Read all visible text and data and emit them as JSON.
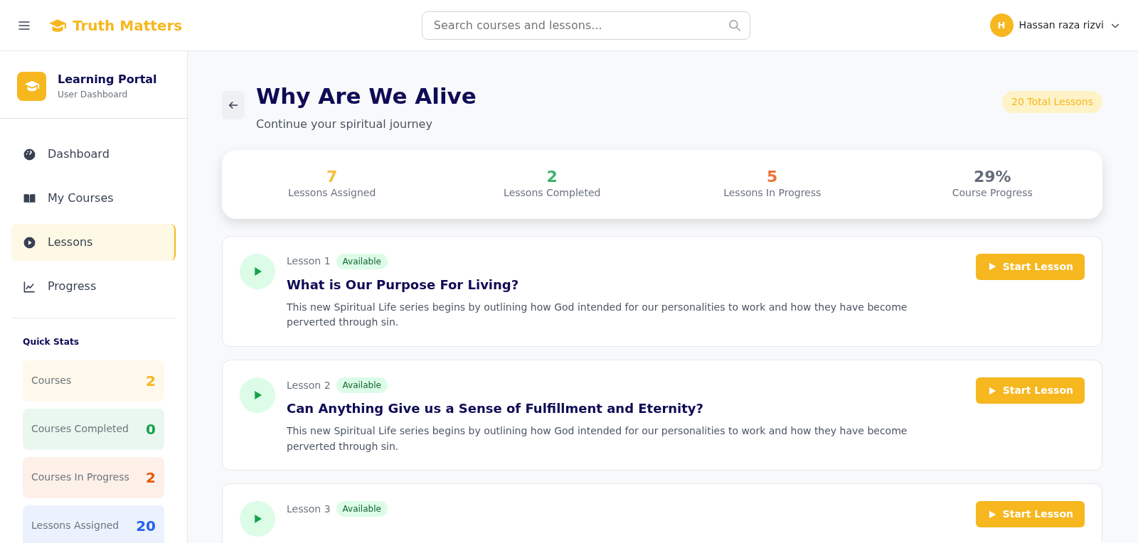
{
  "header": {
    "brand": "Truth Matters",
    "search": {
      "placeholder": "Search courses and lessons..."
    },
    "user": {
      "initial": "H",
      "name": "Hassan raza rizvi"
    }
  },
  "sidebar": {
    "title": "Learning Portal",
    "subtitle": "User Dashboard",
    "items": [
      {
        "label": "Dashboard",
        "selected": false
      },
      {
        "label": "My Courses",
        "selected": false
      },
      {
        "label": "Lessons",
        "selected": true
      },
      {
        "label": "Progress",
        "selected": false
      }
    ],
    "quick_stats_title": "Quick Stats",
    "quick_stats": [
      {
        "label": "Courses",
        "value": "2",
        "color": "#f6b71f"
      },
      {
        "label": "Courses Completed",
        "value": "0",
        "color": "#16a34a"
      },
      {
        "label": "Courses In Progress",
        "value": "2",
        "color": "#ea580c"
      },
      {
        "label": "Lessons Assigned",
        "value": "20",
        "color": "#2563eb"
      }
    ]
  },
  "page": {
    "title": "Why Are We Alive",
    "subtitle": "Continue your spiritual journey",
    "total_badge": "20 Total Lessons"
  },
  "stats": [
    {
      "value": "7",
      "label": "Lessons Assigned",
      "color": "#f5be3b"
    },
    {
      "value": "2",
      "label": "Lessons Completed",
      "color": "#3cb46a"
    },
    {
      "value": "5",
      "label": "Lessons In Progress",
      "color": "#ec7436"
    },
    {
      "value": "29%",
      "label": "Course Progress",
      "color": "#646c7a"
    }
  ],
  "lessons": [
    {
      "number": "Lesson 1",
      "status": "Available",
      "title": "What is Our Purpose For Living?",
      "description": "This new Spiritual Life series begins by outlining how God intended for our personalities to work and how they have become perverted through sin.",
      "button": "Start Lesson"
    },
    {
      "number": "Lesson 2",
      "status": "Available",
      "title": "Can Anything Give us a Sense of Fulfillment and Eternity?",
      "description": "This new Spiritual Life series begins by outlining how God intended for our personalities to work and how they have become perverted through sin.",
      "button": "Start Lesson"
    },
    {
      "number": "Lesson 3",
      "status": "Available",
      "button": "Start Lesson"
    }
  ]
}
